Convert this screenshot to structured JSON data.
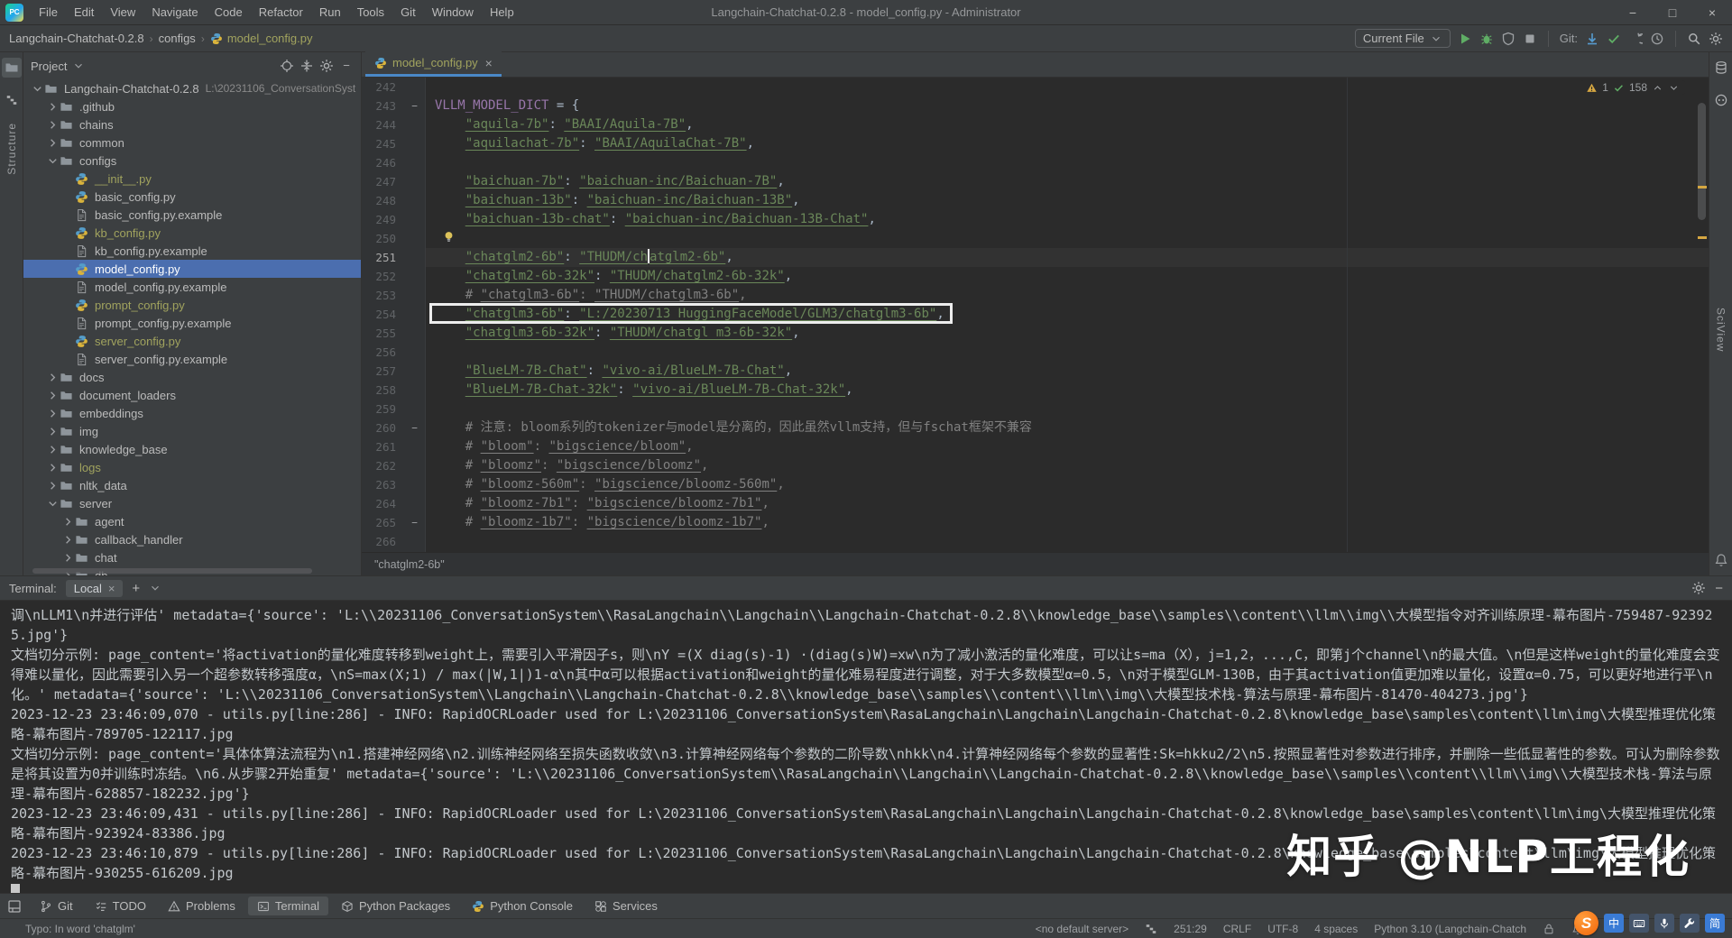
{
  "window": {
    "title": "Langchain-Chatchat-0.2.8 - model_config.py - Administrator",
    "menus": [
      "File",
      "Edit",
      "View",
      "Navigate",
      "Code",
      "Refactor",
      "Run",
      "Tools",
      "Git",
      "Window",
      "Help"
    ]
  },
  "navbar": {
    "breadcrumbs": [
      "Langchain-Chatchat-0.2.8",
      "configs",
      "model_config.py"
    ],
    "run_config": "Current File",
    "git_label": "Git:"
  },
  "stripes": {
    "left_label": "Structure",
    "right_label": "SciView"
  },
  "project": {
    "title": "Project",
    "tree": [
      {
        "d": 0,
        "type": "folder",
        "chev": "down",
        "label": "Langchain-Chatchat-0.2.8",
        "suffix": "L:\\20231106_ConversationSyst"
      },
      {
        "d": 1,
        "type": "folder",
        "chev": "right",
        "label": ".github"
      },
      {
        "d": 1,
        "type": "folder",
        "chev": "right",
        "label": "chains"
      },
      {
        "d": 1,
        "type": "folder",
        "chev": "right",
        "label": "common"
      },
      {
        "d": 1,
        "type": "folder",
        "chev": "down",
        "label": "configs"
      },
      {
        "d": 2,
        "type": "python",
        "label": "__init__.py",
        "ignored": true
      },
      {
        "d": 2,
        "type": "python",
        "label": "basic_config.py"
      },
      {
        "d": 2,
        "type": "file",
        "label": "basic_config.py.example"
      },
      {
        "d": 2,
        "type": "python",
        "label": "kb_config.py",
        "ignored": true
      },
      {
        "d": 2,
        "type": "file",
        "label": "kb_config.py.example"
      },
      {
        "d": 2,
        "type": "python",
        "label": "model_config.py",
        "selected": true
      },
      {
        "d": 2,
        "type": "file",
        "label": "model_config.py.example"
      },
      {
        "d": 2,
        "type": "python",
        "label": "prompt_config.py",
        "ignored": true
      },
      {
        "d": 2,
        "type": "file",
        "label": "prompt_config.py.example"
      },
      {
        "d": 2,
        "type": "python",
        "label": "server_config.py",
        "ignored": true
      },
      {
        "d": 2,
        "type": "file",
        "label": "server_config.py.example"
      },
      {
        "d": 1,
        "type": "folder",
        "chev": "right",
        "label": "docs"
      },
      {
        "d": 1,
        "type": "folder",
        "chev": "right",
        "label": "document_loaders"
      },
      {
        "d": 1,
        "type": "folder",
        "chev": "right",
        "label": "embeddings"
      },
      {
        "d": 1,
        "type": "folder",
        "chev": "right",
        "label": "img"
      },
      {
        "d": 1,
        "type": "folder",
        "chev": "right",
        "label": "knowledge_base"
      },
      {
        "d": 1,
        "type": "folder",
        "chev": "right",
        "label": "logs",
        "ignored": true
      },
      {
        "d": 1,
        "type": "folder",
        "chev": "right",
        "label": "nltk_data"
      },
      {
        "d": 1,
        "type": "folder",
        "chev": "down",
        "label": "server"
      },
      {
        "d": 2,
        "type": "folder",
        "chev": "right",
        "label": "agent"
      },
      {
        "d": 2,
        "type": "folder",
        "chev": "right",
        "label": "callback_handler"
      },
      {
        "d": 2,
        "type": "folder",
        "chev": "right",
        "label": "chat"
      },
      {
        "d": 2,
        "type": "folder",
        "chev": "right",
        "label": "db"
      }
    ]
  },
  "editor": {
    "tab": "model_config.py",
    "inspections": {
      "warnings": "1",
      "ok": "158"
    },
    "breadcrumb": "\"chatglm2-6b\"",
    "lines": [
      {
        "n": "242",
        "seg": []
      },
      {
        "n": "243",
        "fold": "-",
        "seg": [
          [
            "v",
            "VLLM_MODEL_DICT"
          ],
          [
            "p",
            " = {"
          ]
        ]
      },
      {
        "n": "244",
        "seg": [
          [
            "p",
            "    "
          ],
          [
            "s",
            "\"aquila-7b\""
          ],
          [
            "p",
            ": "
          ],
          [
            "s",
            "\"BAAI/Aquila-7B\""
          ],
          [
            "p",
            ","
          ]
        ]
      },
      {
        "n": "245",
        "seg": [
          [
            "p",
            "    "
          ],
          [
            "s",
            "\"aquilachat-7b\""
          ],
          [
            "p",
            ": "
          ],
          [
            "s",
            "\"BAAI/AquilaChat-7B\""
          ],
          [
            "p",
            ","
          ]
        ]
      },
      {
        "n": "246",
        "seg": []
      },
      {
        "n": "247",
        "seg": [
          [
            "p",
            "    "
          ],
          [
            "s",
            "\"baichuan-7b\""
          ],
          [
            "p",
            ": "
          ],
          [
            "s",
            "\"baichuan-inc/Baichuan-7B\""
          ],
          [
            "p",
            ","
          ]
        ]
      },
      {
        "n": "248",
        "seg": [
          [
            "p",
            "    "
          ],
          [
            "s",
            "\"baichuan-13b\""
          ],
          [
            "p",
            ": "
          ],
          [
            "s",
            "\"baichuan-inc/Baichuan-13B\""
          ],
          [
            "p",
            ","
          ]
        ]
      },
      {
        "n": "249",
        "seg": [
          [
            "p",
            "    "
          ],
          [
            "s",
            "\"baichuan-13b-chat\""
          ],
          [
            "p",
            ": "
          ],
          [
            "s",
            "\"baichuan-inc/Baichuan-13B-Chat\""
          ],
          [
            "p",
            ","
          ]
        ]
      },
      {
        "n": "250",
        "seg": [
          [
            "bulb",
            ""
          ]
        ]
      },
      {
        "n": "251",
        "current": true,
        "seg": [
          [
            "p",
            "    "
          ],
          [
            "s",
            "\"chatglm2-6b\""
          ],
          [
            "p",
            ": "
          ],
          [
            "s",
            "\"THUDM/ch"
          ],
          [
            "caret",
            ""
          ],
          [
            "s",
            "atglm2-6b\""
          ],
          [
            "p",
            ","
          ]
        ]
      },
      {
        "n": "252",
        "seg": [
          [
            "p",
            "    "
          ],
          [
            "s",
            "\"chatglm2-6b-32k\""
          ],
          [
            "p",
            ": "
          ],
          [
            "s",
            "\"THUDM/chatglm2-6b-32k\""
          ],
          [
            "p",
            ","
          ]
        ]
      },
      {
        "n": "253",
        "seg": [
          [
            "p",
            "    "
          ],
          [
            "c",
            "# "
          ],
          [
            "cu",
            "\"chatglm3-6b\""
          ],
          [
            "c",
            ": "
          ],
          [
            "cu",
            "\"THUDM/chatglm3-6b\""
          ],
          [
            "c",
            ","
          ]
        ]
      },
      {
        "n": "254",
        "boxed": true,
        "seg": [
          [
            "p",
            "    "
          ],
          [
            "s",
            "\"chatglm3-6b\""
          ],
          [
            "p",
            ": "
          ],
          [
            "s",
            "\"L:/20230713_HuggingFaceModel/GLM3/chatglm3-6b\""
          ],
          [
            "p",
            ","
          ]
        ]
      },
      {
        "n": "255",
        "seg": [
          [
            "p",
            "    "
          ],
          [
            "s",
            "\"chatglm3-6b-32k\""
          ],
          [
            "p",
            ": "
          ],
          [
            "s",
            "\"THUDM/chatgl m3-6b-32k\""
          ],
          [
            "p",
            ","
          ]
        ]
      },
      {
        "n": "256",
        "seg": []
      },
      {
        "n": "257",
        "seg": [
          [
            "p",
            "    "
          ],
          [
            "s",
            "\"BlueLM-7B-Chat\""
          ],
          [
            "p",
            ": "
          ],
          [
            "s",
            "\"vivo-ai/BlueLM-7B-Chat\""
          ],
          [
            "p",
            ","
          ]
        ]
      },
      {
        "n": "258",
        "seg": [
          [
            "p",
            "    "
          ],
          [
            "s",
            "\"BlueLM-7B-Chat-32k\""
          ],
          [
            "p",
            ": "
          ],
          [
            "s",
            "\"vivo-ai/BlueLM-7B-Chat-32k\""
          ],
          [
            "p",
            ","
          ]
        ]
      },
      {
        "n": "259",
        "seg": []
      },
      {
        "n": "260",
        "fold": "-",
        "seg": [
          [
            "p",
            "    "
          ],
          [
            "c",
            "# 注意: bloom系列的tokenizer与model是分离的，因此虽然vllm支持，但与fschat框架不兼容"
          ]
        ]
      },
      {
        "n": "261",
        "seg": [
          [
            "p",
            "    "
          ],
          [
            "c",
            "# "
          ],
          [
            "cu",
            "\"bloom\""
          ],
          [
            "c",
            ": "
          ],
          [
            "cu",
            "\"bigscience/bloom\""
          ],
          [
            "c",
            ","
          ]
        ]
      },
      {
        "n": "262",
        "seg": [
          [
            "p",
            "    "
          ],
          [
            "c",
            "# "
          ],
          [
            "cu",
            "\"bloomz\""
          ],
          [
            "c",
            ": "
          ],
          [
            "cu",
            "\"bigscience/bloomz\""
          ],
          [
            "c",
            ","
          ]
        ]
      },
      {
        "n": "263",
        "seg": [
          [
            "p",
            "    "
          ],
          [
            "c",
            "# "
          ],
          [
            "cu",
            "\"bloomz-560m\""
          ],
          [
            "c",
            ": "
          ],
          [
            "cu",
            "\"bigscience/bloomz-560m\""
          ],
          [
            "c",
            ","
          ]
        ]
      },
      {
        "n": "264",
        "seg": [
          [
            "p",
            "    "
          ],
          [
            "c",
            "# "
          ],
          [
            "cu",
            "\"bloomz-7b1\""
          ],
          [
            "c",
            ": "
          ],
          [
            "cu",
            "\"bigscience/bloomz-7b1\""
          ],
          [
            "c",
            ","
          ]
        ]
      },
      {
        "n": "265",
        "fold": "-",
        "seg": [
          [
            "p",
            "    "
          ],
          [
            "c",
            "# "
          ],
          [
            "cu",
            "\"bloomz-1b7\""
          ],
          [
            "c",
            ": "
          ],
          [
            "cu",
            "\"bigscience/bloomz-1b7\""
          ],
          [
            "c",
            ","
          ]
        ]
      },
      {
        "n": "266",
        "seg": []
      }
    ]
  },
  "terminal": {
    "title": "Terminal:",
    "tab": "Local",
    "lines": [
      "调\\nLLM1\\n并进行评估' metadata={'source': 'L:\\\\20231106_ConversationSystem\\\\RasaLangchain\\\\Langchain\\\\Langchain-Chatchat-0.2.8\\\\knowledge_base\\\\samples\\\\content\\\\llm\\\\img\\\\大模型指令对齐训练原理-幕布图片-759487-923925.jpg'}",
      "文档切分示例: page_content='将activation的量化难度转移到weight上，需要引入平滑因子s，则\\nY =(X diag(s)-1) ·(diag(s)W)=xw\\n为了减小激活的量化难度，可以让s=ma（X），j=1,2，...,C，即第j个channel\\n的最大值。\\n但是这样weight的量化难度会变得难以量化，因此需要引入另一个超参数转移强度α，\\nS=max(X;1) / max(|W,1|)1-α\\n其中α可以根据activation和weight的量化难易程度进行调整，对于大多数模型α=0.5，\\n对于模型GLM-130B，由于其activation值更加难以量化，设置α=0.75，可以更好地进行平\\n化。' metadata={'source': 'L:\\\\20231106_ConversationSystem\\\\Langchain\\\\Langchain-Chatchat-0.2.8\\\\knowledge_base\\\\samples\\\\content\\\\llm\\\\img\\\\大模型技术栈-算法与原理-幕布图片-81470-404273.jpg'}",
      "2023-12-23 23:46:09,070 - utils.py[line:286] - INFO: RapidOCRLoader used for L:\\20231106_ConversationSystem\\RasaLangchain\\Langchain\\Langchain-Chatchat-0.2.8\\knowledge_base\\samples\\content\\llm\\img\\大模型推理优化策略-幕布图片-789705-122117.jpg",
      "文档切分示例: page_content='具体体算法流程为\\n1.搭建神经网络\\n2.训练神经网络至损失函数收敛\\n3.计算神经网络每个参数的二阶导数\\nhkk\\n4.计算神经网络每个参数的显著性:Sk=hkku2/2\\n5.按照显著性对参数进行排序，并删除一些低显著性的参数。可认为删除参数是将其设置为0并训练时冻结。\\n6.从步骤2开始重复' metadata={'source': 'L:\\\\20231106_ConversationSystem\\\\RasaLangchain\\\\Langchain\\\\Langchain-Chatchat-0.2.8\\\\knowledge_base\\\\samples\\\\content\\\\llm\\\\img\\\\大模型技术栈-算法与原理-幕布图片-628857-182232.jpg'}",
      "2023-12-23 23:46:09,431 - utils.py[line:286] - INFO: RapidOCRLoader used for L:\\20231106_ConversationSystem\\RasaLangchain\\Langchain\\Langchain-Chatchat-0.2.8\\knowledge_base\\samples\\content\\llm\\img\\大模型推理优化策略-幕布图片-923924-83386.jpg",
      "2023-12-23 23:46:10,879 - utils.py[line:286] - INFO: RapidOCRLoader used for L:\\20231106_ConversationSystem\\RasaLangchain\\Langchain\\Langchain-Chatchat-0.2.8\\knowledge_base\\samples\\content\\llm\\img\\大模型推理优化策略-幕布图片-930255-616209.jpg"
    ]
  },
  "toolbar_bottom": {
    "tabs": [
      {
        "icon": "branch",
        "label": "Git"
      },
      {
        "icon": "todo",
        "label": "TODO"
      },
      {
        "icon": "problems",
        "label": "Problems"
      },
      {
        "icon": "terminal",
        "label": "Terminal",
        "active": true
      },
      {
        "icon": "pkg",
        "label": "Python Packages"
      },
      {
        "icon": "python",
        "label": "Python Console"
      },
      {
        "icon": "services",
        "label": "Services"
      }
    ]
  },
  "status": {
    "left": "Typo: In word 'chatglm'",
    "items": [
      "<no default server>",
      "251:29",
      "CRLF",
      "UTF-8",
      "4 spaces",
      "Python 3.10 (Langchain-Chatch"
    ]
  },
  "ime": {
    "logo": "S",
    "lang": "中",
    "simplified": "简"
  },
  "watermark": {
    "text": "知乎 @NLP工程化"
  },
  "colors": {
    "selection_blue": "#4b6eaf",
    "string_green": "#6a8759",
    "comment_gray": "#808080",
    "ignored_olive": "#a1a35e",
    "warning_yellow": "#d6a742",
    "ok_green": "#5fad65",
    "editor_bg": "#2b2b2b",
    "panel_bg": "#3c3f41",
    "tab_underline": "#4a88c7"
  }
}
